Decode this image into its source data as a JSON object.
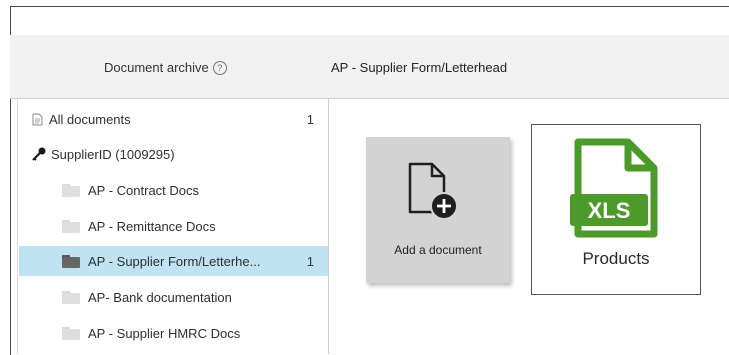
{
  "header": {
    "archive_label": "Document archive",
    "help_glyph": "?",
    "title": "AP - Supplier Form/Letterhead"
  },
  "tree": {
    "items": [
      {
        "label": "All documents",
        "count": "1",
        "icon": "documents-icon"
      },
      {
        "label": "SupplierID (1009295)",
        "count": "",
        "icon": "key-icon"
      },
      {
        "label": "AP - Contract Docs",
        "count": "",
        "icon": "folder-icon"
      },
      {
        "label": "AP - Remittance Docs",
        "count": "",
        "icon": "folder-icon"
      },
      {
        "label": "AP - Supplier Form/Letterhe...",
        "count": "1",
        "icon": "folder-icon",
        "selected": true
      },
      {
        "label": "AP- Bank documentation",
        "count": "",
        "icon": "folder-icon"
      },
      {
        "label": "AP - Supplier HMRC Docs",
        "count": "",
        "icon": "folder-icon"
      }
    ]
  },
  "cards": {
    "add_label": "Add a document",
    "file_name": "Products",
    "file_type": "XLS"
  },
  "colors": {
    "selected_row": "#bfe3f3",
    "xls_green": "#4c9a2a",
    "header_bg": "#f1f1f1",
    "add_card_bg": "#d3d3d3"
  }
}
